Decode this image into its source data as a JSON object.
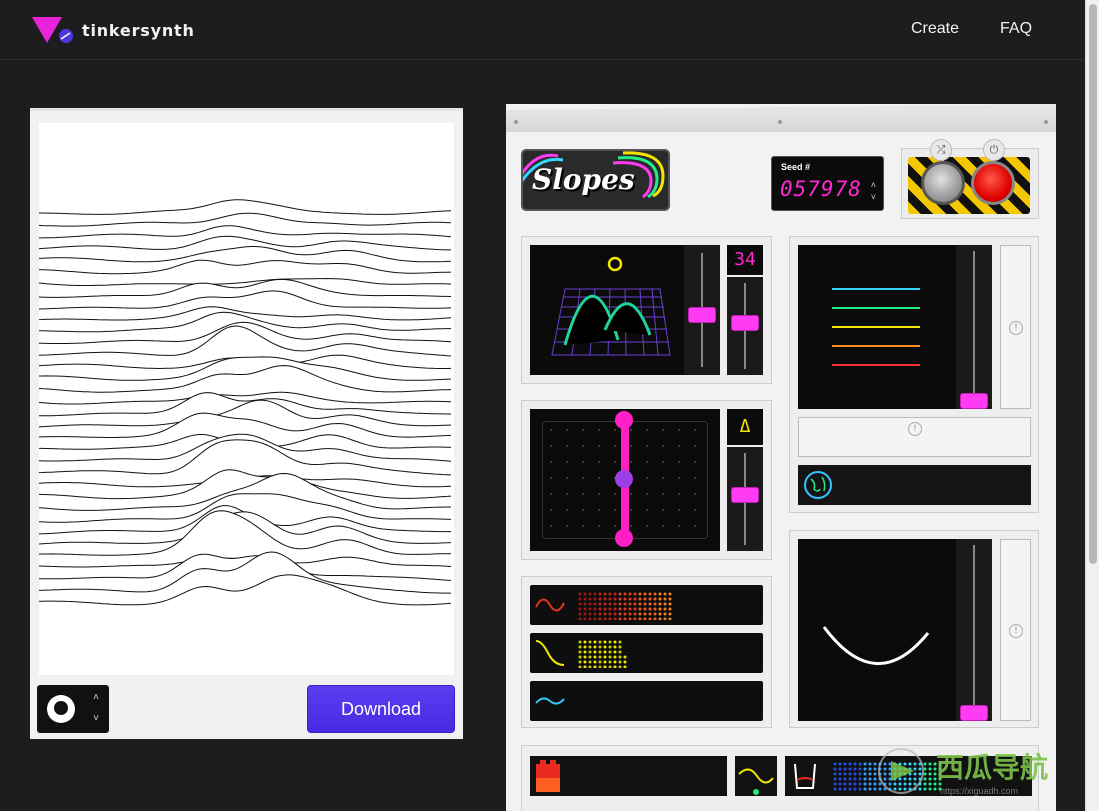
{
  "header": {
    "brand": "tinkersynth",
    "nav": [
      {
        "label": "Create"
      },
      {
        "label": "FAQ"
      }
    ]
  },
  "canvas": {
    "download_label": "Download",
    "stepper_up": "˄",
    "stepper_down": "˅"
  },
  "synth": {
    "title": "Slopes",
    "seed": {
      "label": "Seed #",
      "value": "057978"
    },
    "controls": {
      "lines_count": "34",
      "triangle_symbol": "Δ",
      "info_symbol": "!"
    },
    "button_icons": {
      "shuffle": "⤮",
      "power": "⏻"
    }
  },
  "watermark": {
    "text": "西瓜导航",
    "url": "https://xiguadh.com"
  },
  "colors": {
    "accent_pink": "#ff3bf3",
    "download_purple": "#4a2ae0",
    "seed_magenta": "#ff2ad1",
    "hazard_yellow": "#f4c800"
  }
}
